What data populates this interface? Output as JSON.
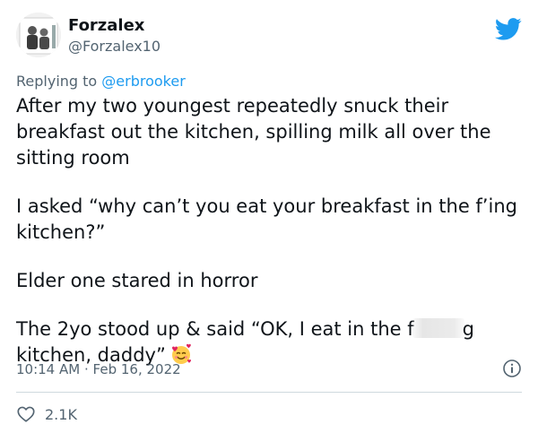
{
  "tweet": {
    "author": {
      "display_name": "Forzalex",
      "handle": "@Forzalex10",
      "avatar_icon": "profile-photo"
    },
    "platform_icon": "twitter-bird-icon",
    "brand_color": "#1d9bf0",
    "replying_prefix": "Replying to ",
    "replying_to": "@erbrooker",
    "paragraphs": [
      "After my two youngest repeatedly snuck their breakfast out the kitchen, spilling milk all over the sitting room",
      "I asked “why can’t you eat your breakfast in the f’ing kitchen?”",
      "Elder one stared in horror"
    ],
    "last_paragraph": {
      "before_censor": "The 2yo stood up & said “OK, I eat in the f",
      "after_censor": "g kitchen, daddy”",
      "emoji": "smiling-face-with-hearts"
    },
    "time": "10:14 AM",
    "separator": "·",
    "date": "Feb 16, 2022",
    "likes": "2.1K"
  }
}
